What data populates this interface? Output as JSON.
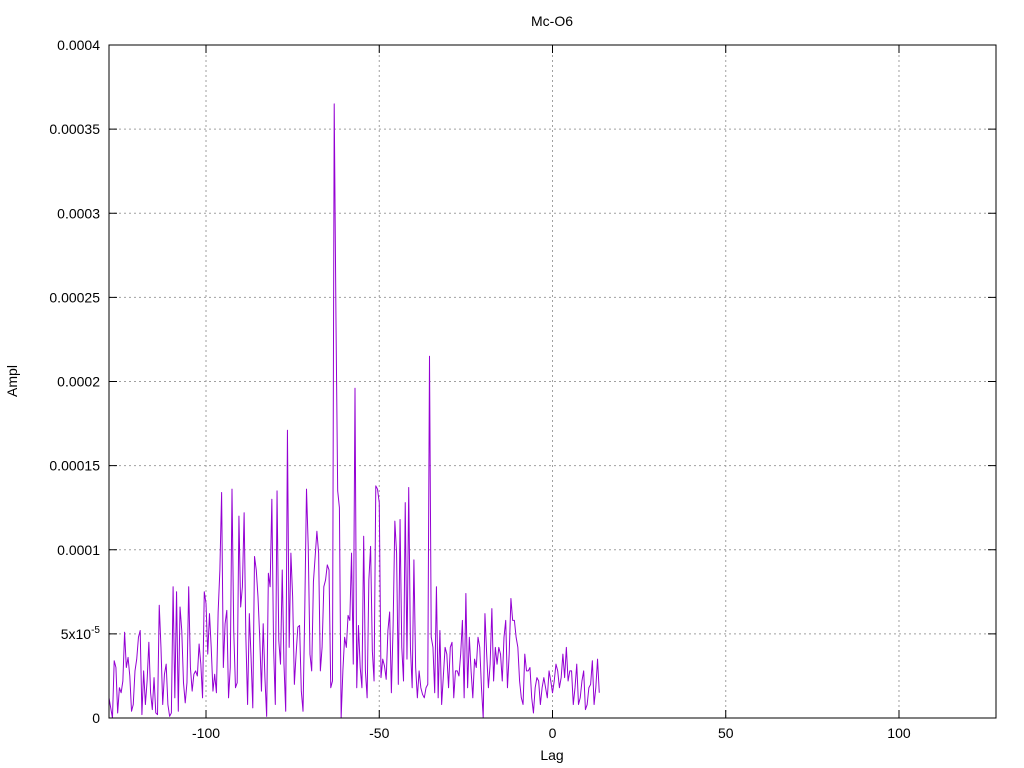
{
  "chart_data": {
    "type": "line",
    "title": "Mc-O6",
    "xlabel": "Lag",
    "ylabel": "Ampl",
    "xlim": [
      -128,
      128
    ],
    "ylim": [
      0,
      0.0004
    ],
    "grid": true,
    "x_ticks": [
      -100,
      -50,
      0,
      50,
      100
    ],
    "x_tick_labels": [
      "-100",
      "-50",
      "0",
      "50",
      "100"
    ],
    "y_ticks": [
      0,
      5e-05,
      0.0001,
      0.00015,
      0.0002,
      0.00025,
      0.0003,
      0.00035,
      0.0004
    ],
    "y_tick_labels": [
      "0",
      "5x10-5",
      "0.0001",
      "0.00015",
      "0.0002",
      "0.00025",
      "0.0003",
      "0.00035",
      "0.0004"
    ],
    "series": [
      {
        "color": "#9400d3",
        "x_start": -128,
        "x_step": 0.5,
        "values": [
          1.2e-05,
          6e-06,
          0.0,
          3.4e-05,
          3e-05,
          3e-06,
          1.8e-05,
          1.5e-05,
          2.2e-05,
          5.1e-05,
          3e-05,
          3.6e-05,
          2.5e-05,
          4e-06,
          8e-06,
          2.8e-05,
          3.5e-05,
          4.8e-05,
          5.2e-05,
          2e-06,
          2.8e-05,
          8e-06,
          2.2e-05,
          4.5e-05,
          1.5e-05,
          5e-06,
          2.4e-05,
          3e-06,
          2e-06,
          6.7e-05,
          4.2e-05,
          8e-06,
          2.6e-05,
          3.2e-05,
          8e-06,
          1e-06,
          3e-06,
          7.8e-05,
          1.2e-05,
          7.5e-05,
          4e-06,
          6.6e-05,
          5.2e-05,
          2.1e-05,
          9e-06,
          2.1e-05,
          7.8e-05,
          3e-05,
          1.6e-05,
          2.6e-05,
          2.8e-05,
          2.5e-05,
          4.4e-05,
          3.2e-05,
          1.2e-05,
          7.5e-05,
          6.8e-05,
          3.8e-05,
          6.2e-05,
          4.2e-05,
          1.6e-05,
          2.6e-05,
          1.5e-05,
          6.3e-05,
          8.8e-05,
          0.000134,
          3e-05,
          5.6e-05,
          6.4e-05,
          1.2e-05,
          3e-05,
          0.000136,
          5.2e-05,
          1.8e-05,
          2.1e-05,
          0.00012,
          6.6e-05,
          7.8e-05,
          0.000122,
          4.8e-05,
          8e-06,
          6.2e-05,
          3.6e-05,
          6e-06,
          9.6e-05,
          8.8e-05,
          7.2e-05,
          4.8e-05,
          1.6e-05,
          5.6e-05,
          2.4e-05,
          1e-06,
          8.6e-05,
          7.8e-05,
          0.00013,
          4.2e-05,
          8e-06,
          0.000135,
          4.6e-05,
          3.2e-05,
          8.8e-05,
          3.2e-05,
          4e-06,
          0.000171,
          4.2e-05,
          9.8e-05,
          7.2e-05,
          2e-05,
          3.8e-05,
          5.4e-05,
          5.5e-05,
          1.6e-05,
          4e-06,
          6.4e-05,
          0.000136,
          0.000102,
          3.8e-05,
          2.8e-05,
          8.1e-05,
          9.6e-05,
          0.000111,
          9.8e-05,
          2.8e-05,
          4.2e-05,
          7.8e-05,
          8.2e-05,
          9.1e-05,
          8.8e-05,
          1.8e-05,
          2.2e-05,
          0.000365,
          0.000238,
          0.000135,
          0.000125,
          0.0,
          2.8e-05,
          4.8e-05,
          4.2e-05,
          6.1e-05,
          5.8e-05,
          9.8e-05,
          3.2e-05,
          0.000196,
          1.8e-05,
          5.5e-05,
          3e-05,
          1.8e-05,
          0.000108,
          2.8e-05,
          1.2e-05,
          8.2e-05,
          0.000102,
          4e-05,
          2.2e-05,
          0.000138,
          0.000136,
          0.000128,
          2.4e-05,
          3.5e-05,
          3.1e-05,
          2.3e-05,
          5.2e-05,
          6.3e-05,
          1.5e-05,
          5.5e-05,
          0.000117,
          9.8e-05,
          2e-05,
          0.000118,
          4.2e-05,
          2.2e-05,
          0.000128,
          3.5e-05,
          0.000137,
          4.2e-05,
          1.8e-05,
          9.4e-05,
          3e-05,
          1.2e-05,
          2.8e-05,
          1.8e-05,
          1.4e-05,
          1.2e-05,
          1.8e-05,
          2e-05,
          0.000215,
          4.8e-05,
          4.2e-05,
          1.5e-05,
          7.8e-05,
          1.2e-05,
          5.2e-05,
          8e-06,
          2.5e-05,
          4.2e-05,
          3.8e-05,
          1.8e-05,
          4.2e-05,
          4.5e-05,
          1.2e-05,
          2.8e-05,
          2.8e-05,
          2.5e-05,
          3.8e-05,
          5.8e-05,
          1.2e-05,
          7.4e-05,
          1.8e-05,
          4.8e-05,
          2.8e-05,
          1.2e-05,
          3.5e-05,
          3e-05,
          4.8e-05,
          4.2e-05,
          1.8e-05,
          0.0,
          6.2e-05,
          3.8e-05,
          1.8e-05,
          3.2e-05,
          6.5e-05,
          2.2e-05,
          4.2e-05,
          3.2e-05,
          4.2e-05,
          3.8e-05,
          2.2e-05,
          4.8e-05,
          5.8e-05,
          1.8e-05,
          3.8e-05,
          7.1e-05,
          5.8e-05,
          5.8e-05,
          4.8e-05,
          4.2e-05,
          2.2e-05,
          1.2e-05,
          8e-06,
          3.8e-05,
          2.8e-05,
          2.8e-05,
          3e-05,
          1.2e-05,
          3e-06,
          1.8e-05,
          2.4e-05,
          2.2e-05,
          8e-06,
          1.8e-05,
          2.4e-05,
          1.8e-05,
          1.2e-05,
          2.8e-05,
          2.2e-05,
          1.5e-05,
          2.2e-05,
          3.2e-05,
          2.8e-05,
          1.8e-05,
          2.4e-05,
          3.8e-05,
          2.4e-05,
          4.2e-05,
          2.2e-05,
          2.8e-05,
          2.8e-05,
          8e-06,
          1.8e-05,
          3.2e-05,
          8e-06,
          1.2e-05,
          2.2e-05,
          2.8e-05,
          5e-06,
          8e-06,
          1.8e-05,
          2e-05,
          3.4e-05,
          8e-06,
          1.8e-05,
          3.5e-05,
          1.5e-05
        ]
      }
    ]
  }
}
